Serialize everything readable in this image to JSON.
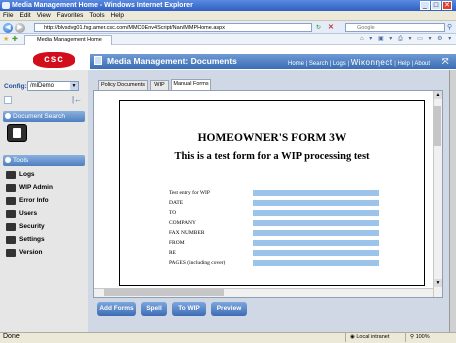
{
  "window": {
    "title": "Media Management Home - Windows Internet Explorer",
    "min": "_",
    "max": "□",
    "close": "✕"
  },
  "menu": [
    "File",
    "Edit",
    "View",
    "Favorites",
    "Tools",
    "Help"
  ],
  "address": {
    "url": "http://blvsdvg01.fsg.amer.csc.com/MMC0Env4Script/Nan/MMPHome.aspx",
    "search_placeholder": "Google"
  },
  "ie_tab": {
    "label": "Media Management Home"
  },
  "header": {
    "logo": "csc",
    "app_title": "Media Management: Documents",
    "links": "Home | Search | Logs |",
    "brand": "Wiκonηect",
    "links2": "| Help | About"
  },
  "sidebar": {
    "config_label": "Config:",
    "config_value": "/mlDemo",
    "document_search": "Document Search",
    "tools": "Tools",
    "items": [
      "Logs",
      "WIP Admin",
      "Error Info",
      "Users",
      "Security",
      "Settings",
      "Version"
    ]
  },
  "tabs": [
    "Policy Documents",
    "WIP",
    "Manual Forms"
  ],
  "form": {
    "title": "HOMEOWNER'S FORM 3W",
    "subtitle": "This is a test form for a WIP processing test",
    "rows": [
      "Test entry for WIP",
      "DATE",
      "TO",
      "COMPANY",
      "FAX NUMBER",
      "FROM",
      "RE",
      "PAGES (including cover)"
    ]
  },
  "actions": [
    "Add Forms",
    "Spell",
    "To WIP",
    "Preview"
  ],
  "status": {
    "left": "Done",
    "zone": "Local intranet",
    "zoom": "100%"
  },
  "colors": {
    "brand_red": "#d20d1c",
    "header_blue": "#3a6db5",
    "field_blue": "#9cc3ea"
  }
}
